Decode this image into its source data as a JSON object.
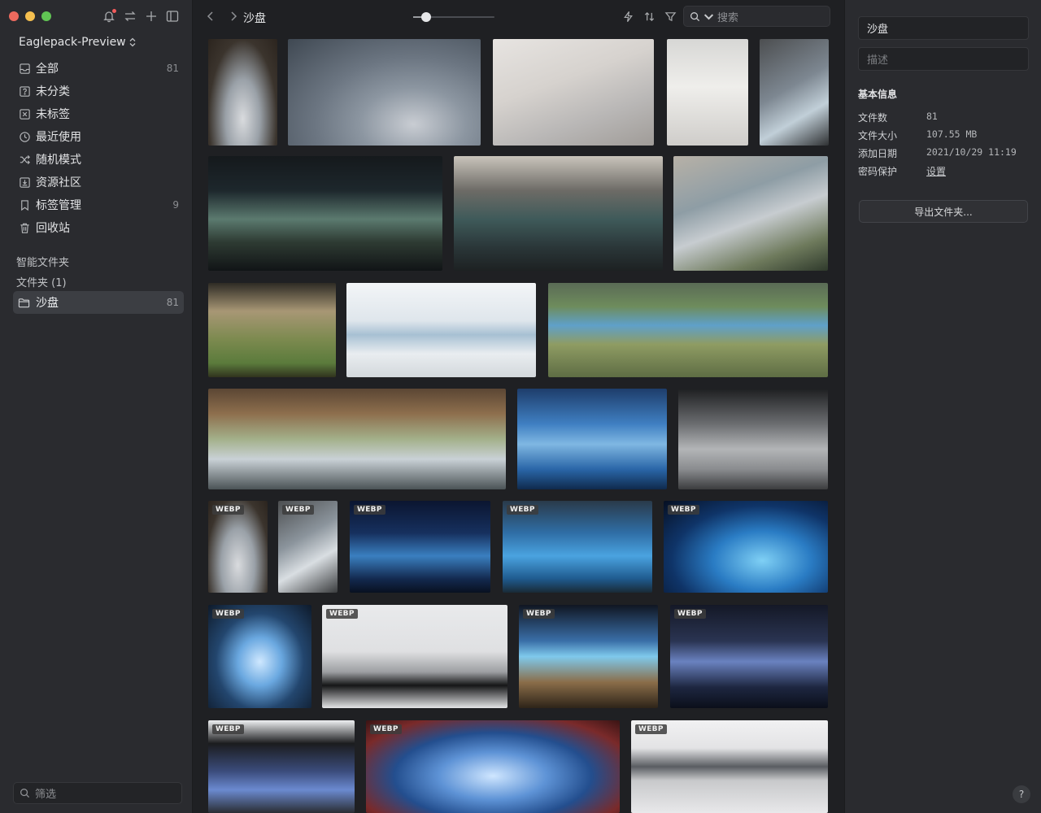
{
  "sidebar": {
    "library": "Eaglepack-Preview",
    "items": [
      {
        "label": "全部",
        "count": "81",
        "icon": "inbox-icon"
      },
      {
        "label": "未分类",
        "count": "",
        "icon": "question-box-icon"
      },
      {
        "label": "未标签",
        "count": "",
        "icon": "tag-off-icon"
      },
      {
        "label": "最近使用",
        "count": "",
        "icon": "clock-icon"
      },
      {
        "label": "随机模式",
        "count": "",
        "icon": "shuffle-icon"
      },
      {
        "label": "资源社区",
        "count": "",
        "icon": "download-box-icon"
      },
      {
        "label": "标签管理",
        "count": "9",
        "icon": "bookmark-icon"
      },
      {
        "label": "回收站",
        "count": "",
        "icon": "trash-icon"
      }
    ],
    "smart_folders_title": "智能文件夹",
    "folders_title": "文件夹 (1)",
    "folder": {
      "label": "沙盘",
      "count": "81"
    },
    "filter_placeholder": "筛选"
  },
  "toolbar": {
    "title": "沙盘",
    "zoom": 0.16,
    "search_placeholder": "搜索"
  },
  "grid": {
    "badge_label": "WEBP"
  },
  "inspector": {
    "title": "沙盘",
    "description_placeholder": "描述",
    "section": "基本信息",
    "rows": [
      {
        "k": "文件数",
        "v": "81"
      },
      {
        "k": "文件大小",
        "v": "107.55 MB"
      },
      {
        "k": "添加日期",
        "v": "2021/10/29 11:19"
      },
      {
        "k": "密码保护",
        "v": "设置"
      }
    ],
    "export_label": "导出文件夹...",
    "help_label": "?"
  },
  "colors": {
    "traffic_close": "#ed6a5e",
    "traffic_min": "#f5bf4f",
    "traffic_max": "#61c454"
  }
}
